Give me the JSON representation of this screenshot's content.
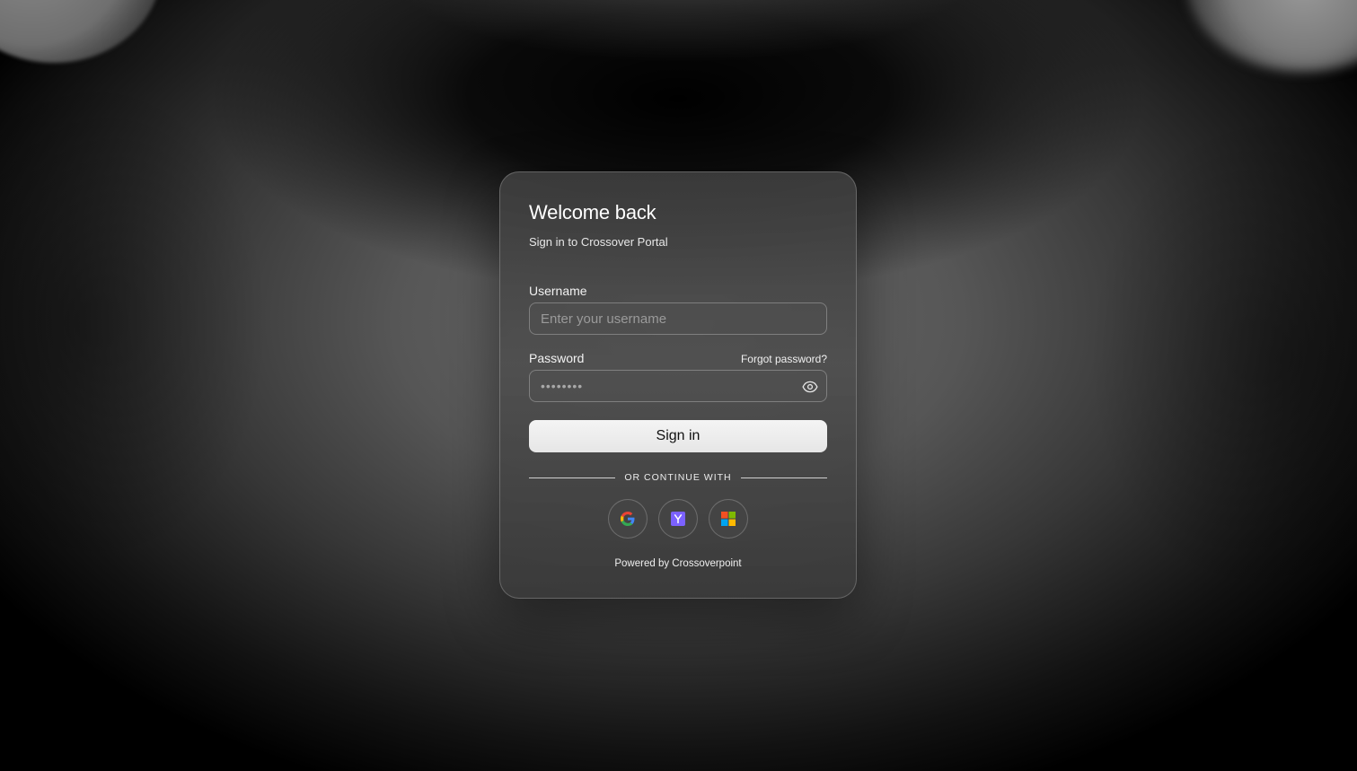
{
  "login": {
    "title": "Welcome back",
    "subtitle": "Sign in to Crossover Portal",
    "username": {
      "label": "Username",
      "placeholder": "Enter your username",
      "value": ""
    },
    "password": {
      "label": "Password",
      "forgot_label": "Forgot password?",
      "placeholder": "••••••••",
      "value": ""
    },
    "submit_label": "Sign in",
    "divider_text": "OR CONTINUE WITH",
    "providers": [
      {
        "icon": "google-icon"
      },
      {
        "icon": "yahoo-icon"
      },
      {
        "icon": "microsoft-icon"
      }
    ],
    "footer": "Powered by Crossoverpoint"
  },
  "colors": {
    "button_bg": "#EDEDED",
    "yahoo_purple": "#7B61FF",
    "ms_red": "#F25022",
    "ms_green": "#7FBA00",
    "ms_blue": "#00A4EF",
    "ms_yellow": "#FFB900"
  }
}
